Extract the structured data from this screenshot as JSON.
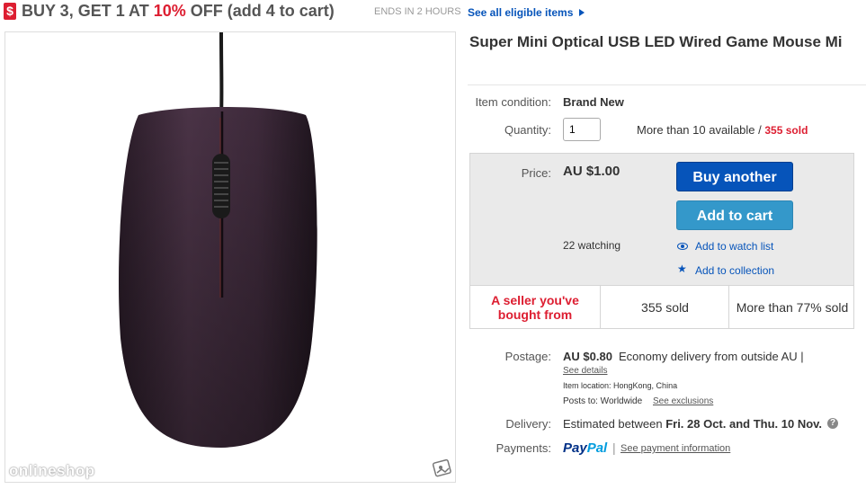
{
  "promo": {
    "badge": "$",
    "headline_part1": "BUY 3, GET 1 AT ",
    "headline_discount": "10%",
    "headline_part2": " OFF (add 4 to cart)",
    "ends": "ENDS IN 2 HOURS",
    "see_all": "See all eligible items"
  },
  "product": {
    "title": "Super Mini Optical USB LED Wired Game Mouse Mi",
    "watermark": "onlineshop"
  },
  "details": {
    "condition_label": "Item condition:",
    "condition_value": "Brand New",
    "quantity_label": "Quantity:",
    "quantity_value": "1",
    "availability": "More than 10 available / ",
    "sold_count": "355 sold",
    "price_label": "Price:",
    "price_value": "AU $1.00",
    "buy_button": "Buy another",
    "cart_button": "Add to cart",
    "watching": "22 watching",
    "watch_link": "Add to watch list",
    "collection_link": "Add to collection"
  },
  "trust": {
    "seller": "A seller you've bought from",
    "sold": "355 sold",
    "positive": "More than 77% sold"
  },
  "shipping": {
    "postage_label": "Postage:",
    "postage_price": "AU $0.80",
    "postage_desc": "Economy delivery from outside AU |",
    "see_details": "See details",
    "item_location": "Item location:  HongKong, China",
    "posts_to_label": "Posts to:  Worldwide",
    "see_exclusions": "See exclusions",
    "delivery_label": "Delivery:",
    "delivery_text": "Estimated between ",
    "delivery_dates": "Fri. 28 Oct. and Thu. 10 Nov.",
    "payments_label": "Payments:",
    "paypal_part1": "Pay",
    "paypal_part2": "Pal",
    "payment_info": "See payment information"
  },
  "colors": {
    "accent_red": "#dd1e31",
    "link_blue": "#0654ba",
    "cart_blue": "#3498ca",
    "mouse_body": "#3b2a3a"
  }
}
